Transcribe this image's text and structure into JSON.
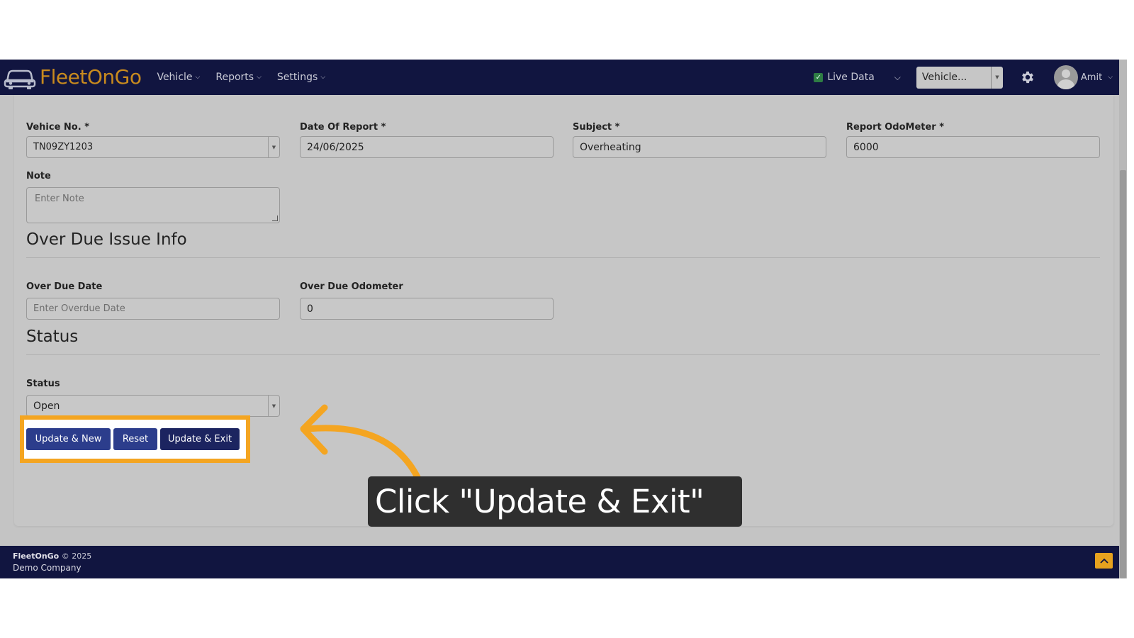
{
  "brand": {
    "name_part1": "Fleet",
    "name_part2": "On",
    "name_part3": "Go"
  },
  "nav": {
    "items": [
      {
        "label": "Vehicle"
      },
      {
        "label": "Reports"
      },
      {
        "label": "Settings"
      }
    ],
    "live_data_label": "Live Data",
    "vehicle_select_value": "Vehicle...",
    "user_name": "Amit"
  },
  "form": {
    "vehicle_no": {
      "label": "Vehice No. *",
      "value": "TN09ZY1203"
    },
    "date_of_report": {
      "label": "Date Of Report *",
      "value": "24/06/2025"
    },
    "subject": {
      "label": "Subject *",
      "value": "Overheating"
    },
    "report_odometer": {
      "label": "Report OdoMeter *",
      "value": "6000"
    },
    "note": {
      "label": "Note",
      "placeholder": "Enter Note"
    },
    "overdue_section_title": "Over Due Issue Info",
    "overdue_date": {
      "label": "Over Due Date",
      "placeholder": "Enter Overdue Date"
    },
    "overdue_odometer": {
      "label": "Over Due Odometer",
      "value": "0"
    },
    "status_section_title": "Status",
    "status": {
      "label": "Status",
      "value": "Open"
    }
  },
  "buttons": {
    "update_new": "Update & New",
    "reset": "Reset",
    "update_exit": "Update & Exit"
  },
  "tooltip": {
    "text": "Click \"Update & Exit\""
  },
  "footer": {
    "brand": "FleetOnGo",
    "copyright": "© 2025",
    "company": "Demo Company"
  },
  "colors": {
    "navbar": "#111540",
    "accent": "#f4a521",
    "primary_button": "#2c3d8c",
    "dark_button": "#1c2460"
  }
}
